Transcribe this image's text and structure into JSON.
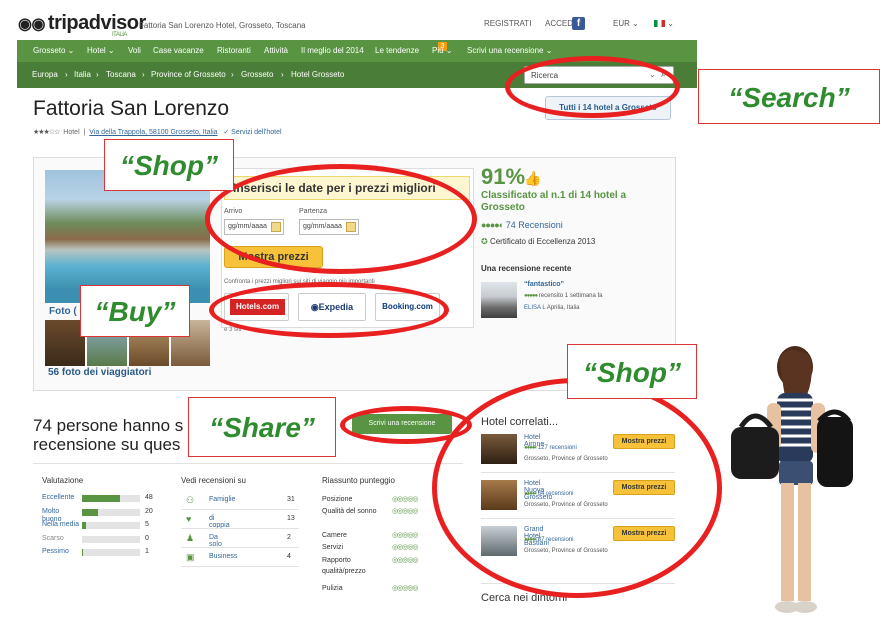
{
  "header": {
    "logo_text": "tripadvisor",
    "logo_sub": "ITALIA",
    "page_title": "Fattoria San Lorenzo Hotel, Grosseto, Toscana",
    "registrati": "REGISTRATI",
    "accedi": "ACCEDI",
    "facebook": "f",
    "currency": "EUR ⌄",
    "flag_menu": "⌄"
  },
  "nav": {
    "items": [
      "Grosseto ⌄",
      "Hotel ⌄",
      "Voli",
      "Case vacanze",
      "Ristoranti",
      "Attività",
      "Il meglio del 2014",
      "Le tendenze",
      "Più ⌄",
      "Scrivi una recensione ⌄"
    ],
    "tendenze_badge": "3"
  },
  "breadcrumb": [
    "Europa",
    "›",
    "Italia",
    "›",
    "Toscana",
    "›",
    "Province of Grosseto",
    "›",
    "Grosseto",
    "›",
    "Hotel Grosseto"
  ],
  "search": {
    "placeholder": "Ricerca"
  },
  "hotel": {
    "name": "Fattoria San Lorenzo",
    "stars": "★★★☆☆",
    "type": "Hotel",
    "address": "Via della Trappola, 58100 Grosseto, Italia",
    "services": "✓ Servizi dell'hotel",
    "all_hotels_button": "Tutti i 14 hotel a Grosseto"
  },
  "photos": {
    "label": "Foto (",
    "link": "56 foto dei viaggiatori"
  },
  "prices": {
    "header": "Inserisci le date per i prezzi migliori",
    "arrivo_label": "Arrivo",
    "partenza_label": "Partenza",
    "arrivo_value": "gg/mm/aaaa",
    "partenza_value": "gg/mm/aaaa",
    "button": "Mostra prezzi",
    "confronta": "Confronta i prezzi migliori sui siti di viaggio più importanti",
    "vendors": [
      "Hotels.com",
      "Expedia",
      "Booking.com"
    ],
    "more": "e 3 siti"
  },
  "rating": {
    "percent": "91%",
    "rank": "Classificato al n.1 di 14 hotel a Grosseto",
    "bubbles": "●●●●◐",
    "reviews": "74 Recensioni",
    "certificate": "Certificato di Eccellenza 2013",
    "recent_header": "Una recensione recente",
    "recent_title": "“fantastico”",
    "recent_when": "recensito 1 settimana fa",
    "recent_author": "ELISA L",
    "recent_place": "Aprilia, Italia"
  },
  "reviews_section": {
    "headline": "74 persone hanno s... recensione su questo hotel",
    "headline_a": "74 persone hanno s",
    "headline_b": "recensione su ques",
    "write_button": "Scrivi una recensione",
    "valutazione_hdr": "Valutazione",
    "valutazione": [
      {
        "label": "Eccellente",
        "count": "48",
        "fill": 0.66
      },
      {
        "label": "Molto buono",
        "count": "20",
        "fill": 0.28
      },
      {
        "label": "Nella media",
        "count": "5",
        "fill": 0.07
      },
      {
        "label": "Scarso",
        "count": "0",
        "fill": 0
      },
      {
        "label": "Pessimo",
        "count": "1",
        "fill": 0.02
      }
    ],
    "vedi_hdr": "Vedi recensioni su",
    "vedi": [
      {
        "icon": "family-icon",
        "label": "Famiglie",
        "count": "31"
      },
      {
        "icon": "heart-icon",
        "label": "di coppia",
        "count": "13"
      },
      {
        "icon": "person-icon",
        "label": "Da solo",
        "count": "2"
      },
      {
        "icon": "briefcase-icon",
        "label": "Business",
        "count": "4"
      }
    ],
    "riassunto_hdr": "Riassunto punteggio",
    "riassunto": [
      "Posizione",
      "Qualità del sonno",
      "Camere",
      "Servizi",
      "Rapporto qualità/prezzo",
      "Pulizia"
    ]
  },
  "related": {
    "header": "Hotel correlati...",
    "items": [
      {
        "name": "Hotel Airone",
        "reviews": "127 recensioni",
        "location": "Grosseto, Province of Grosseto",
        "button": "Mostra prezzi"
      },
      {
        "name": "Hotel Nuova Grosseto",
        "reviews": "64 recensioni",
        "location": "Grosseto, Province of Grosseto",
        "button": "Mostra prezzi"
      },
      {
        "name": "Grand Hotel Bastiani",
        "reviews": "87 recensioni",
        "location": "Grosseto, Province of Grosseto",
        "button": "Mostra prezzi"
      }
    ],
    "nearby": "Cerca nei dintorni"
  },
  "callouts": {
    "search": "“Search”",
    "shop_top": "“Shop”",
    "buy": "“Buy”",
    "share": "“Share”",
    "shop_right": "“Shop”"
  },
  "colors": {
    "brand_green": "#589442",
    "annotation_red": "#e82020",
    "callout_green": "#2e8b2e",
    "price_yellow": "#f7c23a"
  }
}
